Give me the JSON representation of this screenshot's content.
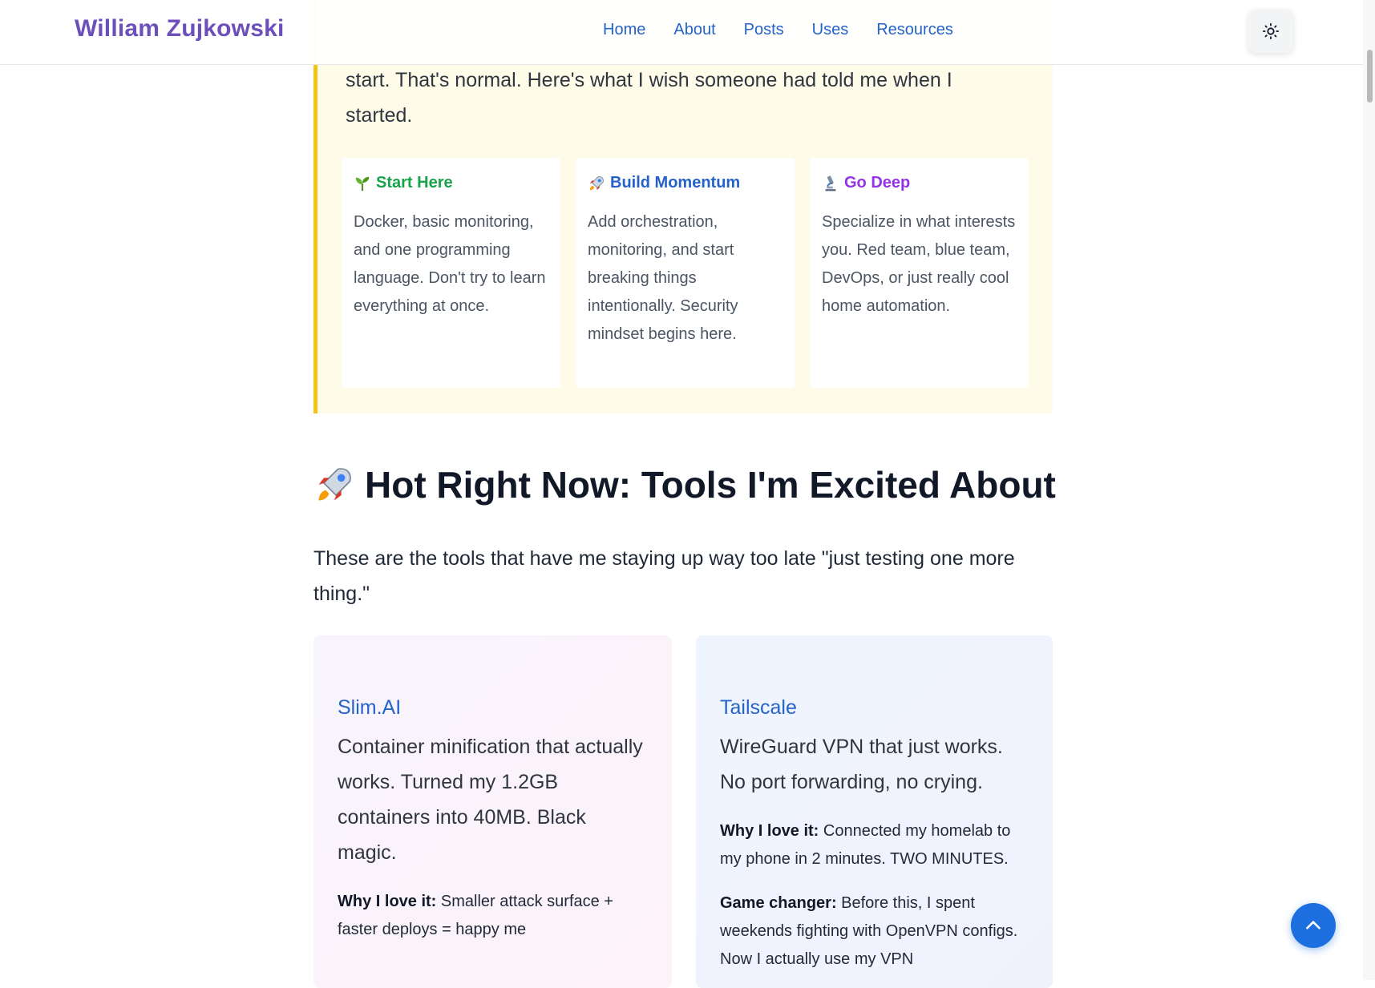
{
  "header": {
    "brand": "William Zujkowski",
    "nav": [
      "Home",
      "About",
      "Posts",
      "Uses",
      "Resources"
    ],
    "theme_icon": "sun-icon"
  },
  "callout": {
    "text": "start. That's normal. Here's what I wish someone had told me when I started.",
    "accent_color": "#f2c418",
    "background_color": "#fefbe8",
    "cards": [
      {
        "icon": "seedling-icon",
        "title": "Start Here",
        "text": "Docker, basic monitoring, and one programming language. Don't try to learn everything at once."
      },
      {
        "icon": "rocket-icon",
        "title": "Build Momentum",
        "text": "Add orchestration, monitoring, and start breaking things intentionally. Security mindset begins here."
      },
      {
        "icon": "microscope-icon",
        "title": "Go Deep",
        "text": "Specialize in what interests you. Red team, blue team, DevOps, or just really cool home automation."
      }
    ]
  },
  "section": {
    "icon": "rocket-icon",
    "title": "Hot Right Now: Tools I'm Excited About",
    "intro": "These are the tools that have me staying up way too late \"just testing one more thing.\""
  },
  "tools": [
    {
      "name": "Slim.AI",
      "description": "Container minification that actually works. Turned my 1.2GB containers into 40MB. Black magic.",
      "notes": [
        {
          "label": "Why I love it:",
          "text": " Smaller attack surface + faster deploys = happy me"
        }
      ]
    },
    {
      "name": "Tailscale",
      "description": "WireGuard VPN that just works. No port forwarding, no crying.",
      "notes": [
        {
          "label": "Why I love it:",
          "text": " Connected my homelab to my phone in 2 minutes. TWO MINUTES."
        },
        {
          "label": "Game changer:",
          "text": " Before this, I spent weekends fighting with OpenVPN configs. Now I actually use my VPN"
        }
      ]
    }
  ],
  "back_to_top_icon": "chevron-up-icon",
  "colors": {
    "brand": "#6b4fbb",
    "link": "#2563c9",
    "start_here": "#16a34a",
    "go_deep": "#9333ea",
    "back_to_top": "#1d6fe0"
  }
}
